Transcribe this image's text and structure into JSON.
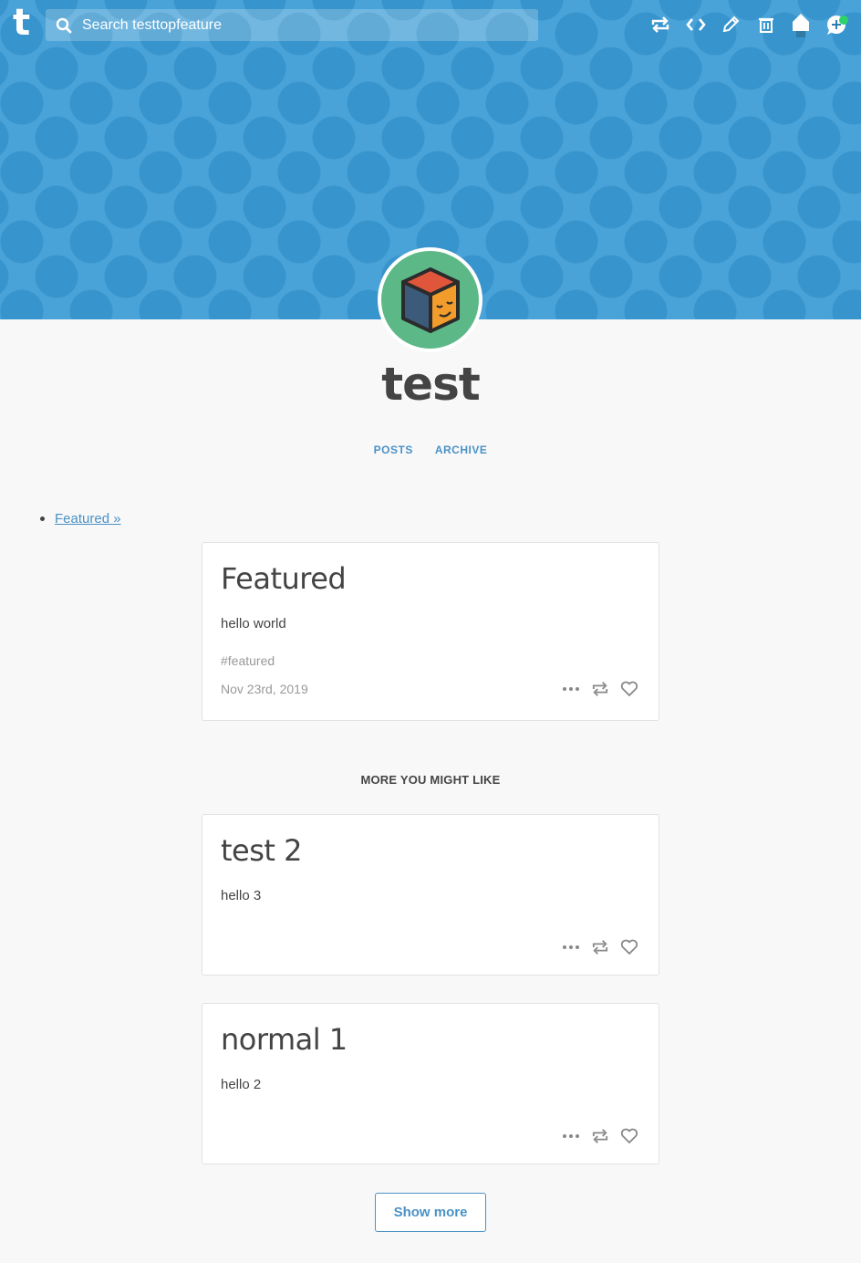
{
  "header": {
    "search_placeholder": "Search testtopfeature",
    "logo_letter": "t",
    "icons": [
      "retweet-icon",
      "code-icon",
      "pencil-icon",
      "trash-icon",
      "home-icon",
      "chat-add-icon"
    ],
    "accent_color": "#4aa3d8",
    "notification_color": "#2ed16a"
  },
  "blog": {
    "title": "test",
    "nav": {
      "posts": "POSTS",
      "archive": "ARCHIVE"
    },
    "featured_link": "Featured »"
  },
  "featured_post": {
    "title": "Featured",
    "body": "hello world",
    "tag": "#featured",
    "date": "Nov 23rd, 2019"
  },
  "more_heading": "MORE YOU MIGHT LIKE",
  "related_posts": [
    {
      "title": "test 2",
      "body": "hello 3"
    },
    {
      "title": "normal 1",
      "body": "hello 2"
    }
  ],
  "show_more_label": "Show more"
}
